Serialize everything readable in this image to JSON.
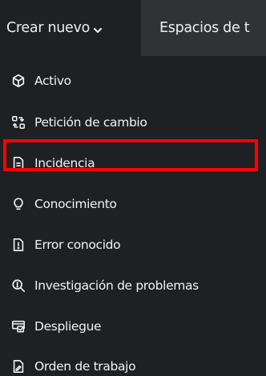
{
  "topbar": {
    "tabs": [
      {
        "label": "Crear nuevo"
      },
      {
        "label": "Espacios de t"
      }
    ]
  },
  "menu": {
    "items": [
      {
        "label": "Activo",
        "icon": "cube-icon"
      },
      {
        "label": "Petición de cambio",
        "icon": "change-request-icon"
      },
      {
        "label": "Incidencia",
        "icon": "document-icon"
      },
      {
        "label": "Conocimiento",
        "icon": "lightbulb-icon"
      },
      {
        "label": "Error conocido",
        "icon": "alert-document-icon"
      },
      {
        "label": "Investigación de problemas",
        "icon": "magnify-alert-icon"
      },
      {
        "label": "Despliegue",
        "icon": "deployment-icon"
      },
      {
        "label": "Orden de trabajo",
        "icon": "signed-document-icon"
      }
    ]
  },
  "colors": {
    "topbar_bg": "#2f3336",
    "menu_bg": "#1e2023",
    "text": "#f2f2f2",
    "highlight": "#ff0000"
  }
}
